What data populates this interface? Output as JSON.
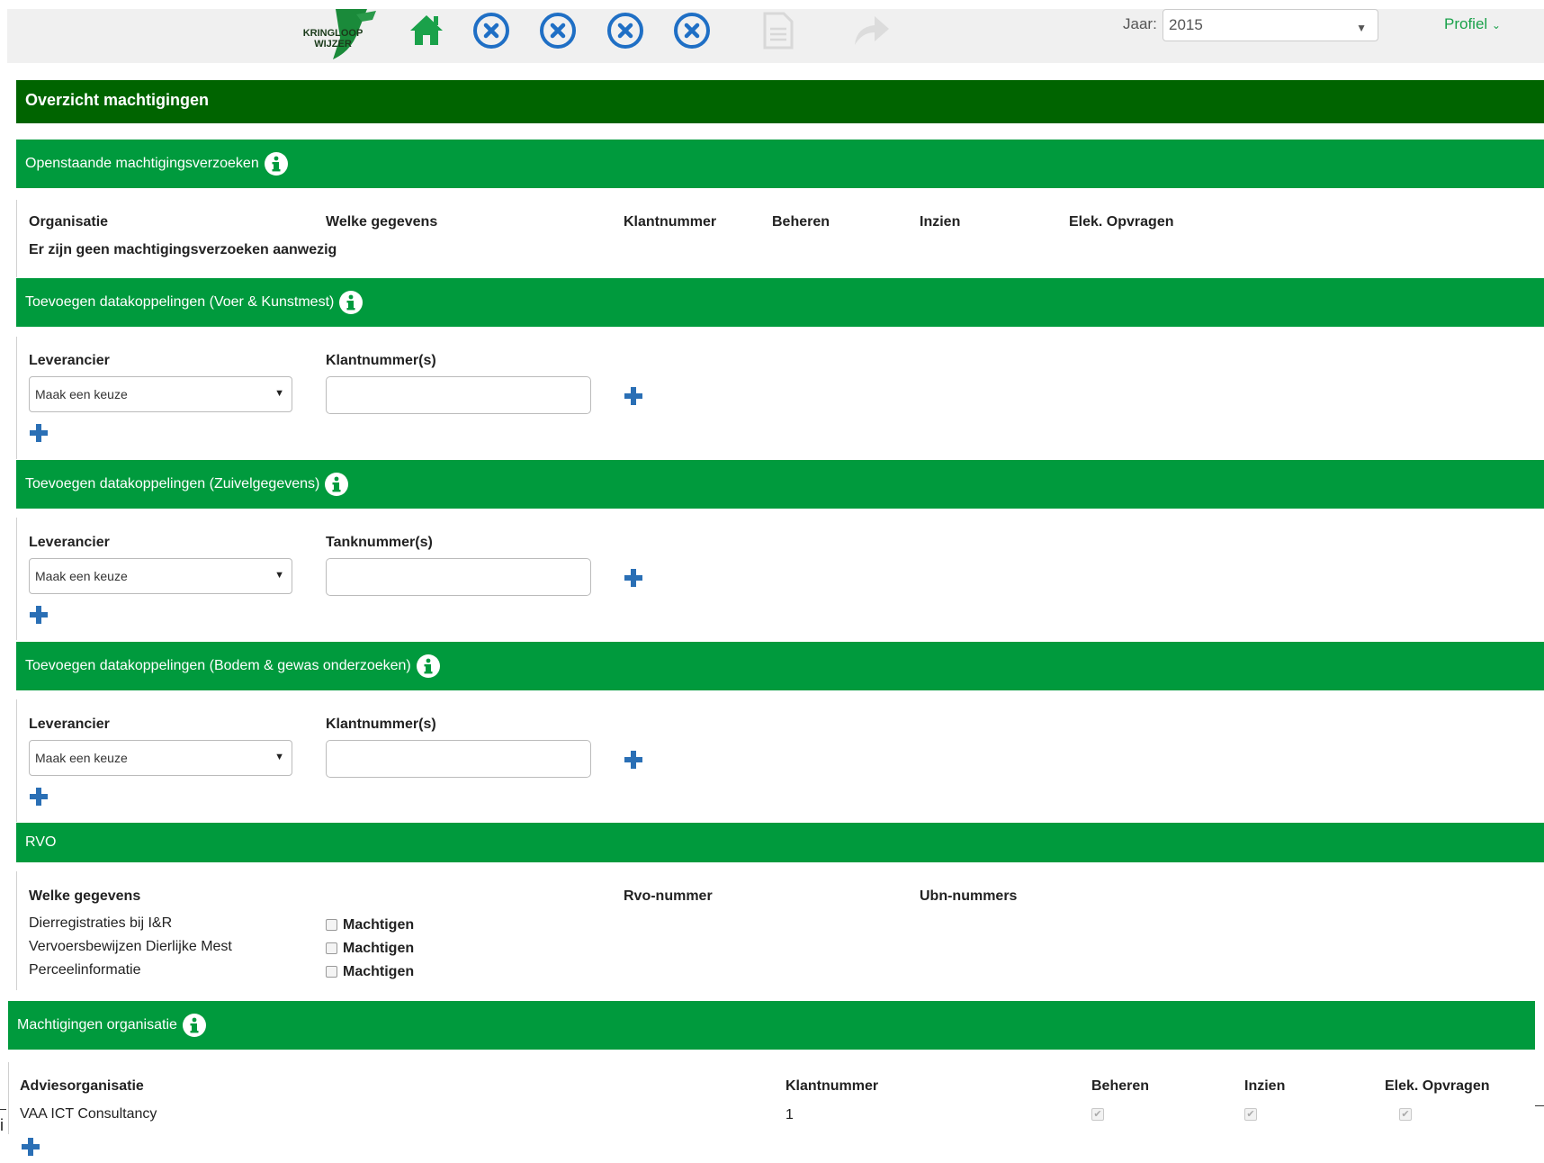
{
  "nav": {
    "logo_line1": "KRINGLOOP",
    "logo_line2": "WIJZER",
    "icons": [
      "home-icon",
      "error-circle-icon",
      "error-circle-icon",
      "error-circle-icon",
      "error-circle-icon",
      "document-icon",
      "share-arrow-icon"
    ],
    "jaar_label": "Jaar:",
    "jaar_value": "2015",
    "profiel": "Profiel"
  },
  "colors": {
    "dark_green": "#006400",
    "green": "#009a3d",
    "plus_blue": "#2a6fb5"
  },
  "page_title": "Overzicht machtigingen",
  "openstaand": {
    "title": "Openstaande machtigingsverzoeken",
    "headers": [
      "Organisatie",
      "Welke gegevens",
      "Klantnummer",
      "Beheren",
      "Inzien",
      "Elek. Opvragen"
    ],
    "empty": "Er zijn geen machtigingsverzoeken aanwezig"
  },
  "voer": {
    "title": "Toevoegen datakoppelingen (Voer & Kunstmest)",
    "col1": "Leverancier",
    "col2": "Klantnummer(s)",
    "select": "Maak een keuze"
  },
  "zuivel": {
    "title": "Toevoegen datakoppelingen (Zuivelgegevens)",
    "col1": "Leverancier",
    "col2": "Tanknummer(s)",
    "select": "Maak een keuze"
  },
  "bodem": {
    "title": "Toevoegen datakoppelingen (Bodem & gewas onderzoeken)",
    "col1": "Leverancier",
    "col2": "Klantnummer(s)",
    "select": "Maak een keuze"
  },
  "rvo": {
    "title": "RVO",
    "headers": [
      "Welke gegevens",
      "Rvo-nummer",
      "Ubn-nummers"
    ],
    "rows": [
      {
        "label": "Dierregistraties bij I&R",
        "check": "Machtigen"
      },
      {
        "label": "Vervoersbewijzen Dierlijke Mest",
        "check": "Machtigen"
      },
      {
        "label": "Perceelinformatie",
        "check": "Machtigen"
      }
    ]
  },
  "organisatie": {
    "title": "Machtigingen organisatie",
    "headers": [
      "Adviesorganisatie",
      "Klantnummer",
      "Beheren",
      "Inzien",
      "Elek. Opvragen"
    ],
    "rows": [
      {
        "name": "VAA ICT Consultancy",
        "klantnummer": "1"
      }
    ]
  },
  "stray_char": "i"
}
